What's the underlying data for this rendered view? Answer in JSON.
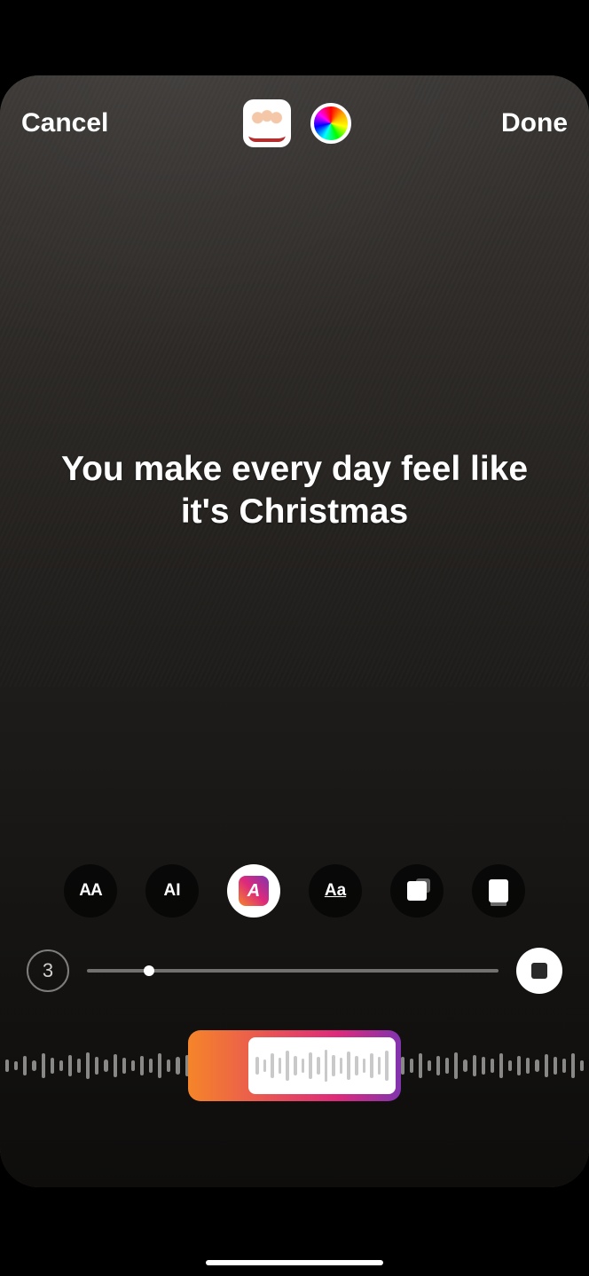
{
  "top": {
    "cancel_label": "Cancel",
    "done_label": "Done"
  },
  "lyrics": {
    "text": "You make every day feel like it's Christmas"
  },
  "styles": {
    "items": [
      {
        "id": "style-bold-caps",
        "label": "AA"
      },
      {
        "id": "style-outline",
        "label": "AI"
      },
      {
        "id": "style-gradient",
        "label": "A"
      },
      {
        "id": "style-underline",
        "label": "Aa"
      },
      {
        "id": "style-card",
        "label": ""
      },
      {
        "id": "style-stack",
        "label": ""
      }
    ],
    "selected_index": 2
  },
  "scrubber": {
    "page": "3",
    "position_pct": 15
  }
}
